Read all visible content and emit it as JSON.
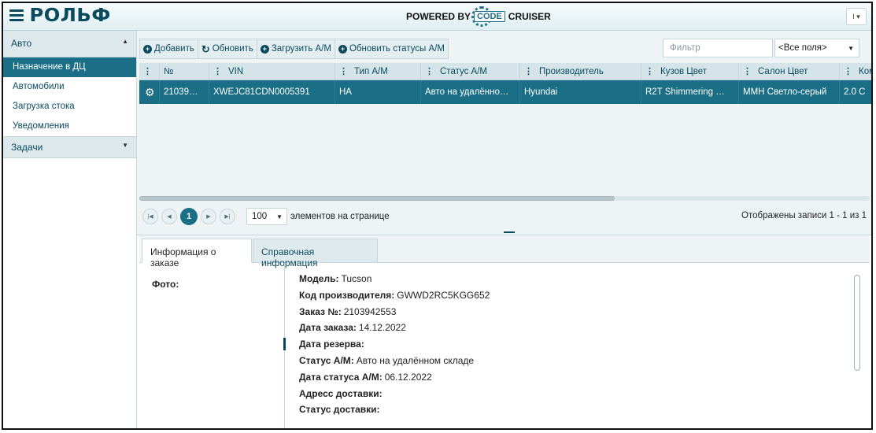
{
  "header": {
    "logo": "РОЛЬФ",
    "powered_prefix": "POWERED BY",
    "powered_code": "CODE",
    "powered_suffix": "CRUISER",
    "user_menu": "I ▾"
  },
  "sidebar": {
    "section_auto": "Авто",
    "items": [
      {
        "label": "Назначение в ДЦ",
        "active": true
      },
      {
        "label": "Автомобили"
      },
      {
        "label": "Загрузка стока"
      },
      {
        "label": "Уведомления"
      }
    ],
    "section_tasks": "Задачи"
  },
  "toolbar": {
    "add": "Добавить",
    "refresh": "Обновить",
    "upload": "Загрузить А/М",
    "update_status": "Обновить статусы А/М",
    "filter_placeholder": "Фильтр",
    "fields_select": "<Все поля>"
  },
  "grid": {
    "columns": [
      "№",
      "VIN",
      "Тип А/М",
      "Статус А/М",
      "Производитель",
      "Кузов Цвет",
      "Салон Цвет",
      "Ком"
    ],
    "row": [
      "21039…",
      "XWEJC81CDN0005391",
      "НА",
      "Авто на удалённо…",
      "Hyundai",
      "R2T Shimmering …",
      "MMH Светло-серый",
      "2.0 C"
    ]
  },
  "pager": {
    "current_page": "1",
    "page_size": "100",
    "page_size_label": "элементов на странице",
    "info": "Отображены записи 1 - 1 из 1"
  },
  "detail": {
    "tab_order": "Информация о заказе",
    "tab_reference": "Справочная информация",
    "photo_label": "Фото:",
    "fields": [
      {
        "k": "Модель:",
        "v": "Tucson"
      },
      {
        "k": "Код производителя:",
        "v": "GWWD2RC5KGG652"
      },
      {
        "k": "Заказ №:",
        "v": "2103942553"
      },
      {
        "k": "Дата заказа:",
        "v": "14.12.2022"
      },
      {
        "k": "Дата резерва:",
        "v": ""
      },
      {
        "k": "Статус А/М:",
        "v": "Авто на удалённом складе"
      },
      {
        "k": "Дата статуса А/М:",
        "v": "06.12.2022"
      },
      {
        "k": "Адресс доставки:",
        "v": ""
      },
      {
        "k": "Статус доставки:",
        "v": ""
      }
    ]
  }
}
